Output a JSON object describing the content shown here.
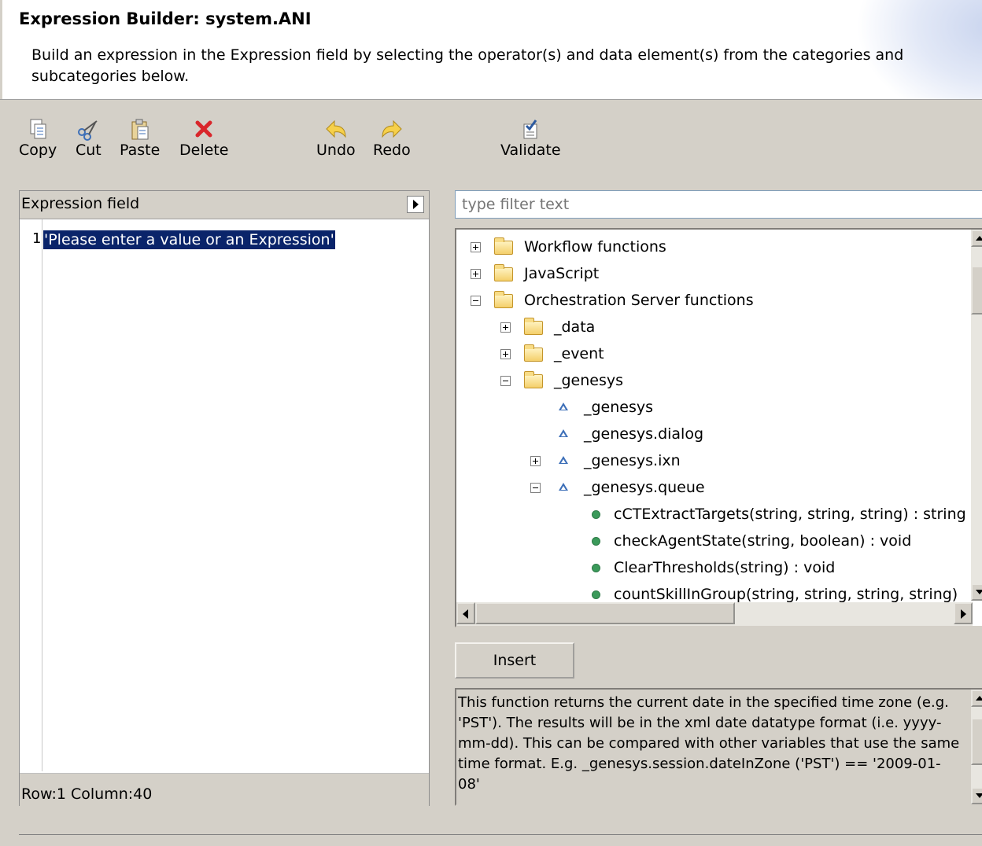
{
  "header": {
    "title": "Expression Builder: system.ANI",
    "description": "Build an expression in the Expression field by selecting the operator(s) and data element(s) from the categories and subcategories below."
  },
  "toolbar": {
    "copy": "Copy",
    "cut": "Cut",
    "paste": "Paste",
    "delete": "Delete",
    "undo": "Undo",
    "redo": "Redo",
    "validate": "Validate"
  },
  "expression": {
    "label": "Expression field",
    "line_number": "1",
    "code": "'Please enter a value or an Expression'",
    "status": "Row:1 Column:40"
  },
  "filter": {
    "placeholder": "type filter text",
    "value": ""
  },
  "tree": {
    "items": [
      {
        "label": "Workflow functions",
        "kind": "folder",
        "state": "collapsed"
      },
      {
        "label": "JavaScript",
        "kind": "folder",
        "state": "collapsed"
      },
      {
        "label": "Orchestration Server functions",
        "kind": "folder",
        "state": "expanded"
      },
      {
        "label": "_data",
        "kind": "folder",
        "state": "collapsed"
      },
      {
        "label": "_event",
        "kind": "folder",
        "state": "collapsed"
      },
      {
        "label": "_genesys",
        "kind": "folder",
        "state": "expanded"
      },
      {
        "label": "_genesys",
        "kind": "object",
        "state": "none"
      },
      {
        "label": "_genesys.dialog",
        "kind": "object",
        "state": "none"
      },
      {
        "label": "_genesys.ixn",
        "kind": "object",
        "state": "collapsed"
      },
      {
        "label": "_genesys.queue",
        "kind": "object",
        "state": "expanded"
      },
      {
        "label": "cCTExtractTargets(string, string, string) : string",
        "kind": "function",
        "state": "none"
      },
      {
        "label": "checkAgentState(string, boolean) : void",
        "kind": "function",
        "state": "none"
      },
      {
        "label": "ClearThresholds(string) : void",
        "kind": "function",
        "state": "none"
      },
      {
        "label": "countSkillInGroup(string, string, string, string)",
        "kind": "function",
        "state": "none"
      }
    ]
  },
  "insert_label": "Insert",
  "help_text": "This function returns the current date in the specified time zone (e.g. 'PST'). The results will be in the xml date datatype format (i.e. yyyy-mm-dd). This can be compared with other variables that use the same time format. E.g. _genesys.session.dateInZone ('PST') == '2009-01-08'",
  "colors": {
    "selection": "#0a246a",
    "folder": "#f4cf6a",
    "function_dot": "#3b9a5a",
    "object_icon": "#3d6fb8",
    "delete_icon": "#d9262b",
    "undo_redo_icon": "#f0c030"
  }
}
